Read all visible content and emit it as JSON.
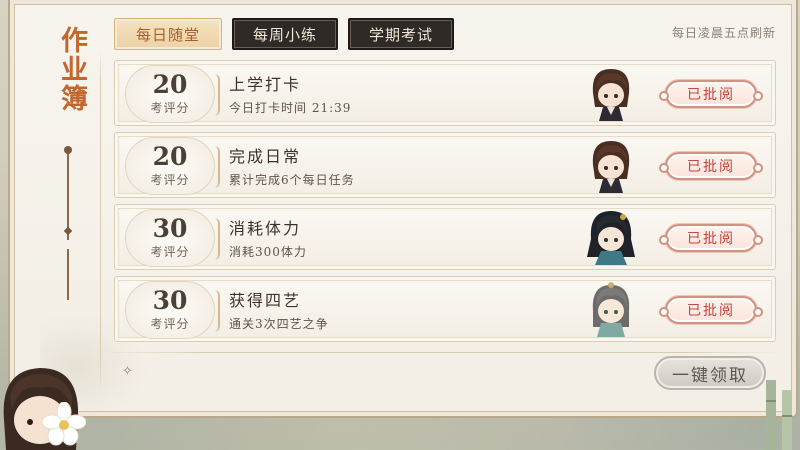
{
  "side_title": "作业簿",
  "tabs": [
    {
      "label": "每日随堂",
      "active": true
    },
    {
      "label": "每周小练",
      "active": false
    },
    {
      "label": "学期考试",
      "active": false
    }
  ],
  "refresh_note": "每日凌晨五点刷新",
  "tasks": [
    {
      "score": "20",
      "score_label": "考评分",
      "title": "上学打卡",
      "desc": "今日打卡时间 21:39",
      "avatar": "chibi-brown-hair-student",
      "status": "已批阅"
    },
    {
      "score": "20",
      "score_label": "考评分",
      "title": "完成日常",
      "desc": "累计完成6个每日任务",
      "avatar": "chibi-brown-hair-student",
      "status": "已批阅"
    },
    {
      "score": "30",
      "score_label": "考评分",
      "title": "消耗体力",
      "desc": "消耗300体力",
      "avatar": "chibi-dark-hair-scholar",
      "status": "已批阅"
    },
    {
      "score": "30",
      "score_label": "考评分",
      "title": "获得四艺",
      "desc": "通关3次四艺之争",
      "avatar": "chibi-grey-hair-scholar",
      "status": "已批阅"
    }
  ],
  "claim_all_label": "一键领取",
  "colors": {
    "accent": "#c2672f",
    "stamp": "#c2433a",
    "tab_dark": "#2e2a28",
    "tab_active": "#ecd2a6"
  }
}
